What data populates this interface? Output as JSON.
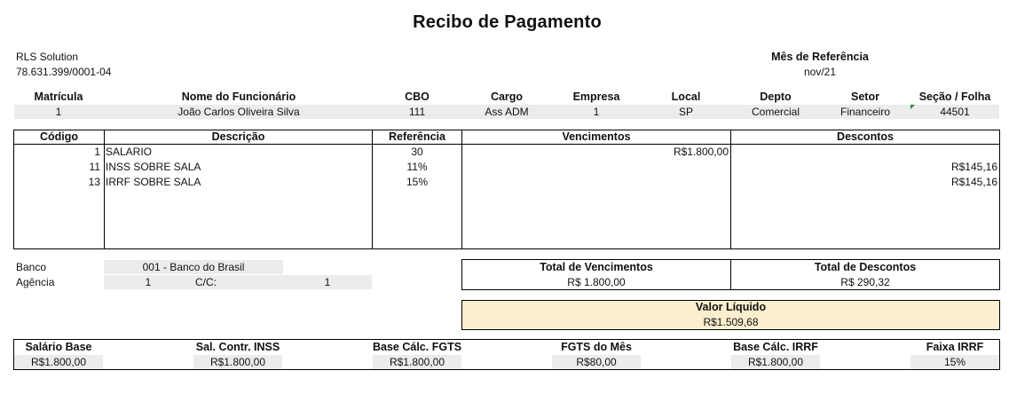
{
  "title": "Recibo de Pagamento",
  "company": {
    "name": "RLS Solution",
    "cnpj": "78.631.399/0001-04"
  },
  "reference": {
    "label": "Mês de Referência",
    "value": "nov/21"
  },
  "employee": {
    "headers": [
      "Matrícula",
      "Nome do Funcionário",
      "CBO",
      "Cargo",
      "Empresa",
      "Local",
      "Depto",
      "Setor",
      "Seção / Folha"
    ],
    "values": [
      "1",
      "João Carlos Oliveira Silva",
      "111",
      "Ass ADM",
      "1",
      "SP",
      "Comercial",
      "Financeiro",
      "44501"
    ]
  },
  "items": {
    "headers": [
      "Código",
      "Descrição",
      "Referência",
      "Vencimentos",
      "Descontos"
    ],
    "rows": [
      {
        "code": "1",
        "desc": "SALARIO",
        "ref": "30",
        "venc": "R$1.800,00",
        "desc_val": ""
      },
      {
        "code": "11",
        "desc": "INSS SOBRE SALA",
        "ref": "11%",
        "venc": "",
        "desc_val": "R$145,16"
      },
      {
        "code": "13",
        "desc": "IRRF SOBRE SALA",
        "ref": "15%",
        "venc": "",
        "desc_val": "R$145,16"
      }
    ]
  },
  "bank": {
    "bank_label": "Banco",
    "bank_value": "001 - Banco do Brasil",
    "agency_label": "Agência",
    "agency_value": "1",
    "account_label": "C/C:",
    "account_value": "1"
  },
  "totals": {
    "venc_label": "Total de Vencimentos",
    "venc_value": "R$ 1.800,00",
    "desc_label": "Total de Descontos",
    "desc_value": "R$ 290,32",
    "net_label": "Valor Líquido",
    "net_value": "R$1.509,68"
  },
  "bases": {
    "headers": [
      "Salário Base",
      "Sal. Contr. INSS",
      "Base Cálc. FGTS",
      "FGTS do Mês",
      "Base Cálc. IRRF",
      "Faixa IRRF"
    ],
    "values": [
      "R$1.800,00",
      "R$1.800,00",
      "R$1.800,00",
      "R$80,00",
      "R$1.800,00",
      "15%"
    ]
  },
  "colors": {
    "gray_fill": "#ececec",
    "net_fill": "#fcefcf",
    "marker": "#1e8a3a"
  }
}
